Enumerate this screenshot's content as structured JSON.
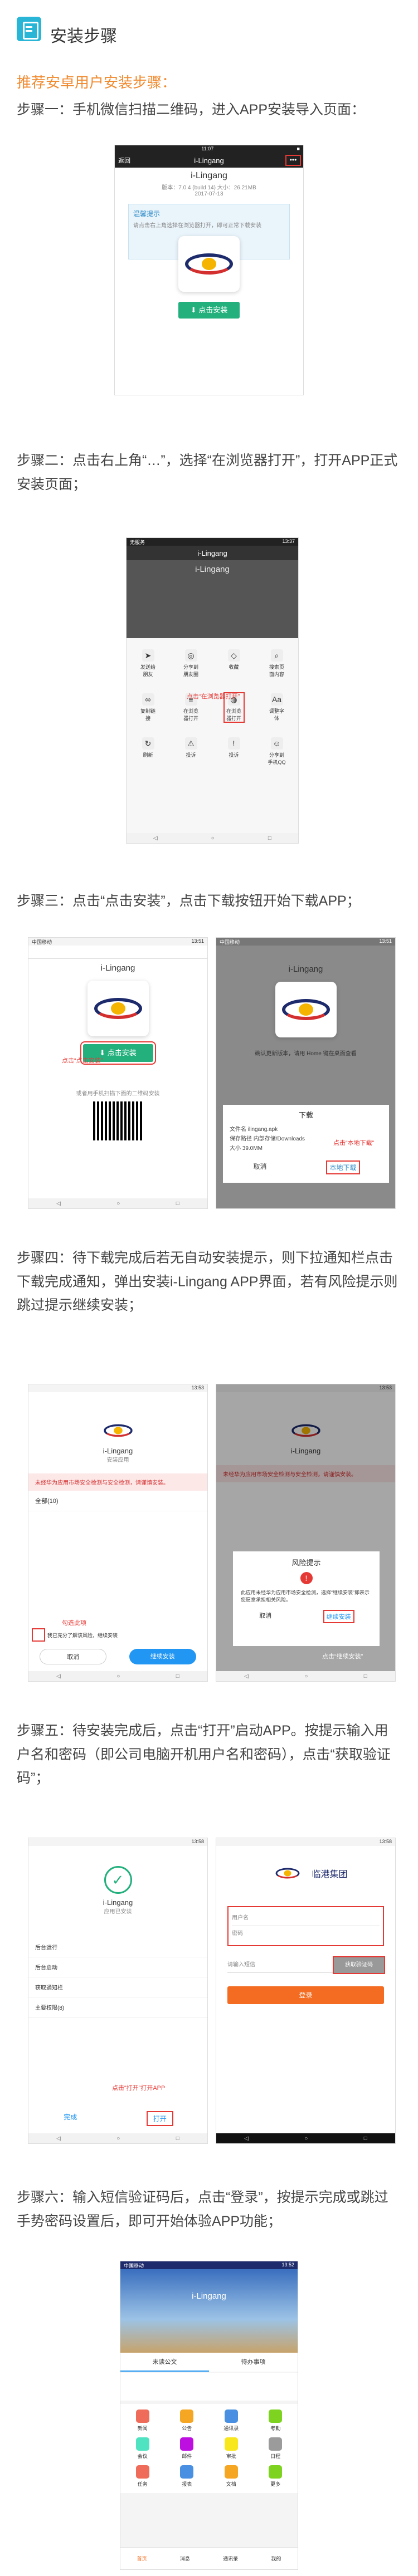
{
  "header": {
    "title": "安装步骤"
  },
  "intro": "推荐安卓用户安装步骤：",
  "steps": {
    "s1": "步骤一：手机微信扫描二维码，进入APP安装导入页面：",
    "s2": "步骤二：点击右上角“…”，选择“在浏览器打开”，打开APP正式安装页面；",
    "s3": "步骤三：点击“点击安装”，点击下载按钮开始下载APP；",
    "s4": "步骤四：待下载完成后若无自动安装提示，则下拉通知栏点击下载完成通知，弹出安装i-Lingang APP界面，若有风险提示则跳过提示继续安装；",
    "s5": "步骤五：待安装完成后，点击“打开”启动APP。按提示输入用户名和密码（即公司电脑开机用户名和密码），点击“获取验证码”；",
    "s6": "步骤六：输入短信验证码后，点击“登录”，按提示完成或跳过手势密码设置后，即可开始体验APP功能；"
  },
  "shot1": {
    "time": "11:07",
    "back": "返回",
    "title": "i-Lingang",
    "dots": "•••",
    "app_name": "i-Lingang",
    "version": "版本：7.0.4 (build 14)   大小：26.21MB",
    "date": "2017-07-13",
    "tip_title": "温馨提示",
    "tip_text": "请点击右上角选择在浏览器打开，即可正常下载安装",
    "install": "点击安装"
  },
  "shot2": {
    "status_left": "无服务",
    "status_right": "13:37",
    "title": "i-Lingang",
    "app_name": "i-Lingang",
    "note": "点击“在浏览器打开”",
    "row1": [
      "发送给朋友",
      "分享到朋友圈",
      "收藏",
      "搜索页面内容"
    ],
    "row2": [
      "复制链接",
      "在浏览器打开",
      "在浏览器打开",
      "调整字体"
    ],
    "row3": [
      "刷新",
      "投诉",
      "投诉",
      "分享到手机QQ"
    ]
  },
  "shot3": {
    "status_left": "中国移动",
    "status_right": "13:51",
    "app_name": "i-Lingang",
    "install": "点击安装",
    "note": "点击“点击安装”",
    "qr_tip": "或者用手机扫描下面的二维码安装",
    "dl_title": "下载",
    "file": "文件名 ilingang.apk",
    "path": "保存路径 内部存储/Downloads",
    "size": "大小 39.0MM",
    "cancel": "取消",
    "download": "本地下载",
    "note2": "点击“本地下载”",
    "warn_text": "确认更新版本，请用 Home 键在桌面查看"
  },
  "shot4": {
    "status_right": "13:53",
    "app_name": "i-Lingang",
    "sub": "安装应用",
    "warning": "未经华为应用市场安全检测与安全检测，请谨慎安装。",
    "perm": "全部(10)",
    "check": "我已充分了解该风险，继续安装",
    "cancel": "取消",
    "install": "继续安装",
    "note": "勾选此项",
    "risk_title": "风险提示",
    "risk_text": "此应用未经华为应用市场安全检测，选择“继续安装”即表示您愿意承担相关风险。",
    "risk_cancel": "取消",
    "risk_go": "继续安装",
    "note2": "点击“继续安装”"
  },
  "shot5": {
    "status_right": "13:58",
    "app_name": "i-Lingang",
    "sub": "应用已安装",
    "items": [
      "后台运行",
      "后台启动",
      "获取通知栏",
      "主要权限(8)"
    ],
    "done": "完成",
    "open": "打开",
    "note": "点击“打开”打开APP",
    "group": "临港集团",
    "user_placeholder": "用户名",
    "pwd_placeholder": "密码",
    "sms_placeholder": "请输入短信",
    "sms_btn": "获取验证码",
    "login": "登录"
  },
  "shot6": {
    "status_left": "中国移动",
    "status_right": "13:52",
    "banner": "i-Lingang",
    "tabs": [
      "未读公文",
      "待办事项"
    ],
    "tiles": [
      "新闻",
      "公告",
      "通讯录",
      "考勤",
      "会议",
      "邮件",
      "审批",
      "日程",
      "任务",
      "报表",
      "文档",
      "更多"
    ],
    "nav": [
      "首页",
      "消息",
      "通讯录",
      "我的"
    ]
  }
}
